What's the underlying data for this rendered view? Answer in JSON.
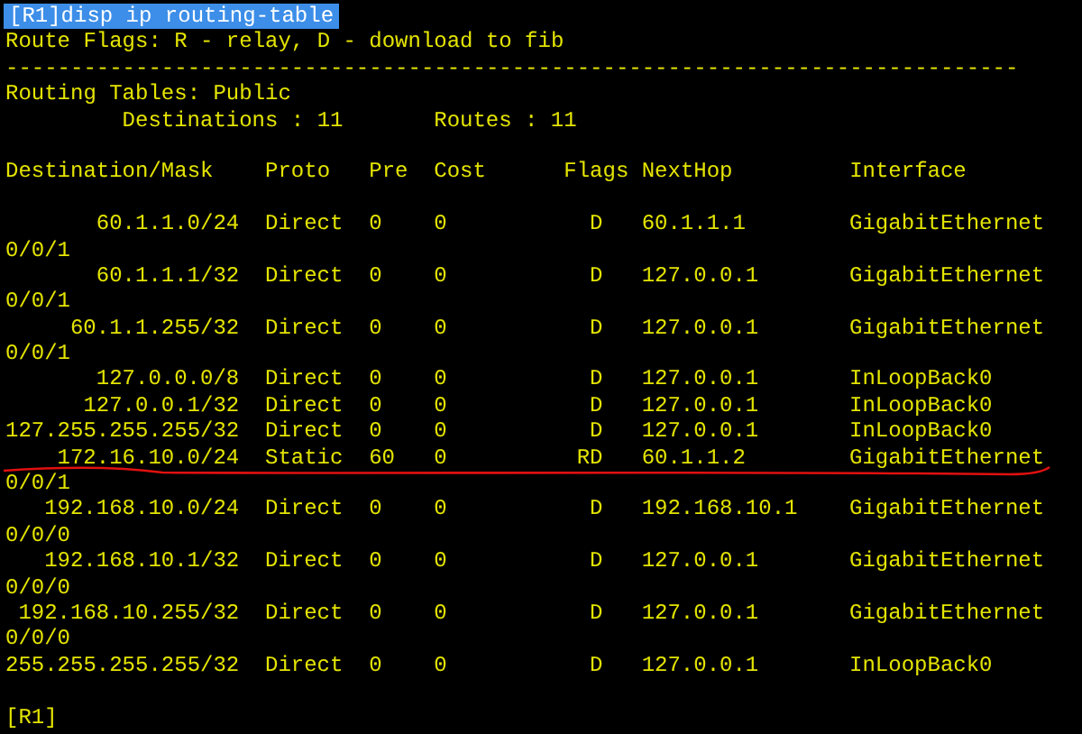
{
  "command": {
    "text": "[R1]disp ip routing-table",
    "selected": true
  },
  "legend": "Route Flags: R - relay, D - download to fib",
  "separator": "------------------------------------------------------------------------------",
  "table_name": "Routing Tables: Public",
  "summary": {
    "destinations": "Destinations : 11",
    "routes": "Routes : 11"
  },
  "columns": [
    "Destination/Mask",
    "Proto",
    "Pre",
    "Cost",
    "Flags",
    "NextHop",
    "Interface"
  ],
  "routes": [
    {
      "destination": "60.1.1.0/24",
      "proto": "Direct",
      "pre": "0",
      "cost": "0",
      "flags": "D",
      "nexthop": "60.1.1.1",
      "interface": "GigabitEthernet",
      "interface_continued": "0/0/1",
      "marked": false
    },
    {
      "destination": "60.1.1.1/32",
      "proto": "Direct",
      "pre": "0",
      "cost": "0",
      "flags": "D",
      "nexthop": "127.0.0.1",
      "interface": "GigabitEthernet",
      "interface_continued": "0/0/1",
      "marked": false
    },
    {
      "destination": "60.1.1.255/32",
      "proto": "Direct",
      "pre": "0",
      "cost": "0",
      "flags": "D",
      "nexthop": "127.0.0.1",
      "interface": "GigabitEthernet",
      "interface_continued": "0/0/1",
      "marked": false
    },
    {
      "destination": "127.0.0.0/8",
      "proto": "Direct",
      "pre": "0",
      "cost": "0",
      "flags": "D",
      "nexthop": "127.0.0.1",
      "interface": "InLoopBack0",
      "marked": false
    },
    {
      "destination": "127.0.0.1/32",
      "proto": "Direct",
      "pre": "0",
      "cost": "0",
      "flags": "D",
      "nexthop": "127.0.0.1",
      "interface": "InLoopBack0",
      "marked": false
    },
    {
      "destination": "127.255.255.255/32",
      "proto": "Direct",
      "pre": "0",
      "cost": "0",
      "flags": "D",
      "nexthop": "127.0.0.1",
      "interface": "InLoopBack0",
      "marked": false
    },
    {
      "destination": "172.16.10.0/24",
      "proto": "Static",
      "pre": "60",
      "cost": "0",
      "flags": "RD",
      "nexthop": "60.1.1.2",
      "interface": "GigabitEthernet",
      "interface_continued": "0/0/1",
      "marked": true
    },
    {
      "destination": "192.168.10.0/24",
      "proto": "Direct",
      "pre": "0",
      "cost": "0",
      "flags": "D",
      "nexthop": "192.168.10.1",
      "interface": "GigabitEthernet",
      "interface_continued": "0/0/0",
      "marked": false
    },
    {
      "destination": "192.168.10.1/32",
      "proto": "Direct",
      "pre": "0",
      "cost": "0",
      "flags": "D",
      "nexthop": "127.0.0.1",
      "interface": "GigabitEthernet",
      "interface_continued": "0/0/0",
      "marked": false
    },
    {
      "destination": "192.168.10.255/32",
      "proto": "Direct",
      "pre": "0",
      "cost": "0",
      "flags": "D",
      "nexthop": "127.0.0.1",
      "interface": "GigabitEthernet",
      "interface_continued": "0/0/0",
      "marked": false
    },
    {
      "destination": "255.255.255.255/32",
      "proto": "Direct",
      "pre": "0",
      "cost": "0",
      "flags": "D",
      "nexthop": "127.0.0.1",
      "interface": "InLoopBack0",
      "marked": false
    }
  ],
  "prompt": "[R1]"
}
